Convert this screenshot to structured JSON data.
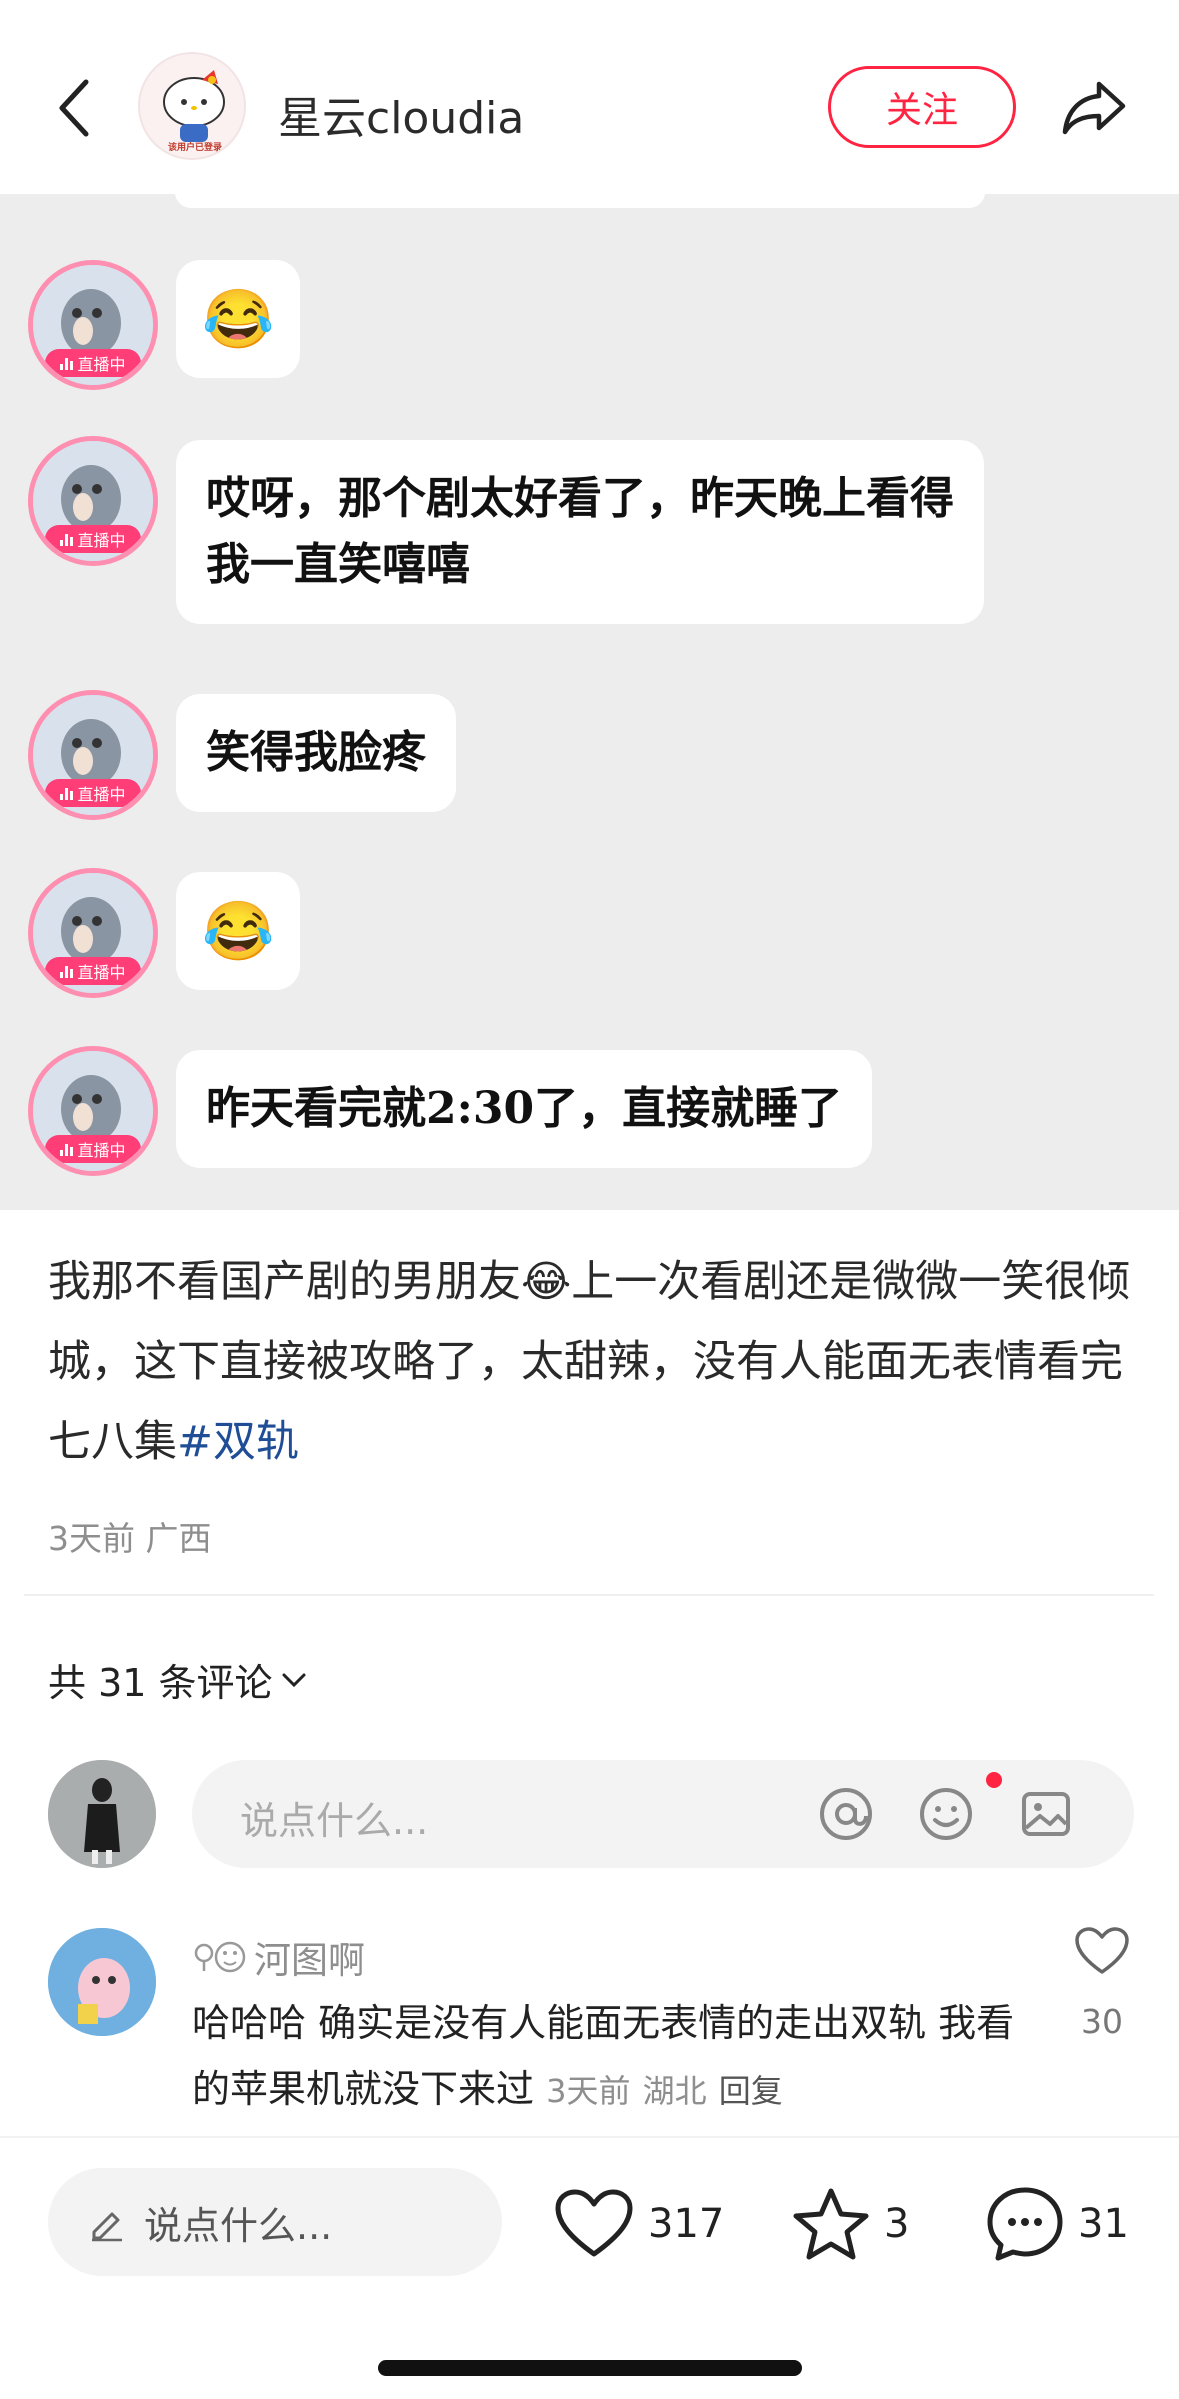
{
  "header": {
    "author_name": "星云cloudia",
    "follow_label": "关注",
    "avatar_caption": "该用户已登录"
  },
  "chat_image": {
    "live_label": "直播中",
    "messages": [
      {
        "type": "emoji",
        "text": "😂"
      },
      {
        "type": "text",
        "text": "哎呀，那个剧太好看了，昨天晚上看得我一直笑嘻嘻"
      },
      {
        "type": "text",
        "text": "笑得我脸疼"
      },
      {
        "type": "emoji",
        "text": "😂"
      },
      {
        "type": "text",
        "text": "昨天看完就2:30了，直接就睡了"
      }
    ]
  },
  "post": {
    "text": "我那不看国产剧的男朋友😂上一次看剧还是微微一笑很倾城，这下直接被攻略了，太甜辣，没有人能面无表情看完七八集",
    "hashtag": "#双轨",
    "meta": "3天前 广西"
  },
  "comments": {
    "count_label": "共 31 条评论",
    "input_placeholder": "说点什么...",
    "items": [
      {
        "user": "河图啊",
        "text": "哈哈哈 确实是没有人能面无表情的走出双轨 我看的苹果机就没下来过",
        "time": "3天前",
        "location": "湖北",
        "reply_label": "回复",
        "likes": "30"
      }
    ]
  },
  "bottom_bar": {
    "input_placeholder": "说点什么...",
    "likes": "317",
    "stars": "3",
    "comments": "31"
  },
  "colors": {
    "accent": "#ff2442",
    "hashtag": "#1f4e96",
    "live_pink": "#ff3d77"
  }
}
